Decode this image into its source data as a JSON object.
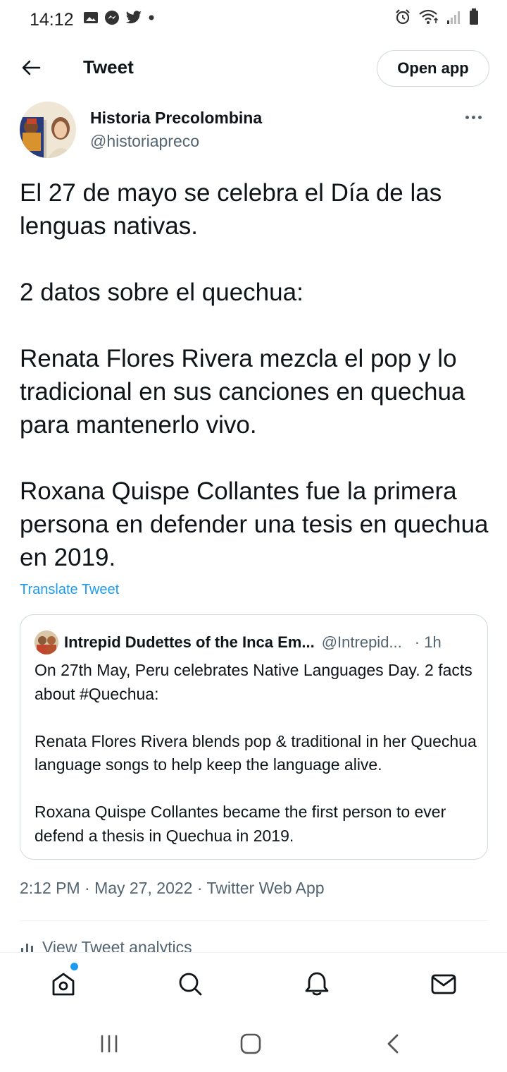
{
  "status_bar": {
    "time": "14:12",
    "left_icons": [
      "gallery-icon",
      "messenger-icon",
      "twitter-icon",
      "dot-icon"
    ],
    "right_icons": [
      "alarm-icon",
      "wifi-icon",
      "signal-icon",
      "battery-icon"
    ]
  },
  "header": {
    "title": "Tweet",
    "open_app_label": "Open app"
  },
  "tweet": {
    "author_name": "Historia Precolombina",
    "author_handle": "@historiapreco",
    "paragraphs": [
      "El 27 de mayo se celebra el Día de las lenguas nativas.",
      "2 datos sobre el quechua:",
      "Renata Flores Rivera mezcla el pop y lo tradicional en sus canciones en quechua para mantenerlo vivo.",
      "Roxana Quispe Collantes fue la primera persona en defender una tesis en quechua en 2019."
    ],
    "translate_label": "Translate Tweet",
    "meta": "2:12 PM · May 27, 2022 · Twitter Web App",
    "analytics_label": "View Tweet analytics"
  },
  "quote": {
    "author_name": "Intrepid Dudettes of the Inca Em...",
    "author_handle": "@Intrepid...",
    "time": "· 1h",
    "paragraphs": [
      "On 27th May, Peru celebrates Native Languages Day. 2 facts about #Quechua:",
      "Renata Flores Rivera blends pop & traditional in her Quechua language songs to help keep the language alive.",
      "Roxana Quispe Collantes became the first person to ever defend a thesis in Quechua in 2019."
    ]
  },
  "bottom_nav": {
    "items": [
      "home-icon",
      "search-icon",
      "notifications-icon",
      "messages-icon"
    ],
    "home_has_notification": true
  },
  "colors": {
    "accent": "#1d9bf0",
    "text_primary": "#0f1419",
    "text_secondary": "#536471",
    "border": "#cfd9de"
  }
}
